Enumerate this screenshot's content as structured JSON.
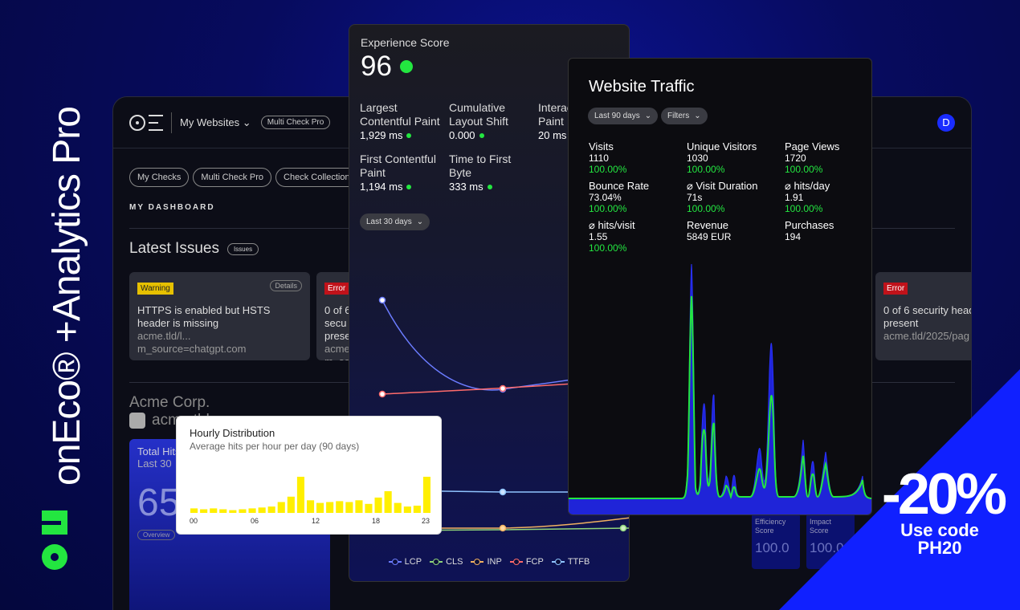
{
  "brand": {
    "vertical_text": "onEco® +Analytics Pro"
  },
  "dashboard": {
    "nav_title": "My Websites",
    "nav_badge": "Multi Check Pro",
    "avatar": "D",
    "tabs": [
      "My Checks",
      "Multi Check Pro",
      "Check Collections"
    ],
    "section_label": "MY DASHBOARD",
    "latest_issues": {
      "title": "Latest Issues",
      "badge": "Issues"
    },
    "issues": [
      {
        "badge": "Warning",
        "details": "Details",
        "text": "HTTPS is enabled but HSTS header is missing",
        "url": "acme.tld/l... m_source=chatgpt.com"
      },
      {
        "badge": "Error",
        "text": "0 of 6 secu present",
        "url": "acme.tld/... m_sou"
      },
      {
        "badge": "Error",
        "text": "0 of 6 security head present",
        "url": "acme.tld/2025/pag"
      }
    ],
    "company": "Acme Corp.",
    "company_domain": "acme.tld",
    "total_card": {
      "title": "Total Hits",
      "subtitle": "Last 30",
      "value": "65",
      "button": "Overview"
    },
    "score_cards": [
      {
        "label": "Efficiency Score",
        "value": "100.0"
      },
      {
        "label": "Impact Score",
        "value": "100.0"
      }
    ]
  },
  "experience": {
    "title": "Experience Score",
    "score": "96",
    "metrics": [
      {
        "label": "Largest Contentful Paint",
        "value": "1,929 ms"
      },
      {
        "label": "Cumulative Layout Shift",
        "value": "0.000"
      },
      {
        "label": "Interaction to Next Paint",
        "value": "20 ms"
      },
      {
        "label": "First Contentful Paint",
        "value": "1,194 ms"
      },
      {
        "label": "Time to First Byte",
        "value": "333 ms"
      }
    ],
    "range": "Last 30 days",
    "legend": [
      {
        "name": "LCP",
        "color": "#6b7cff"
      },
      {
        "name": "CLS",
        "color": "#8fd47a"
      },
      {
        "name": "INP",
        "color": "#f0b060"
      },
      {
        "name": "FCP",
        "color": "#ff6b6b"
      },
      {
        "name": "TTFB",
        "color": "#8fc4ff"
      }
    ]
  },
  "hourly": {
    "title": "Hourly Distribution",
    "subtitle": "Average hits per hour per day (90 days)",
    "ticks": [
      "00",
      "06",
      "12",
      "18",
      "23"
    ],
    "chart_data": {
      "type": "bar",
      "categories": [
        "0",
        "1",
        "2",
        "3",
        "4",
        "5",
        "6",
        "7",
        "8",
        "9",
        "10",
        "11",
        "12",
        "13",
        "14",
        "15",
        "16",
        "17",
        "18",
        "19",
        "20",
        "21",
        "22",
        "23",
        "24"
      ],
      "values": [
        5,
        4,
        5,
        4,
        3,
        4,
        5,
        6,
        7,
        12,
        18,
        40,
        14,
        11,
        12,
        13,
        12,
        14,
        10,
        17,
        24,
        11,
        7,
        8,
        40
      ],
      "color": "#ffef00"
    }
  },
  "traffic": {
    "title": "Website Traffic",
    "range": "Last 90 days",
    "filters": "Filters",
    "metrics": [
      {
        "label": "Visits",
        "value": "1110",
        "pct": "100.00%"
      },
      {
        "label": "Unique Visitors",
        "value": "1030",
        "pct": "100.00%"
      },
      {
        "label": "Page Views",
        "value": "1720",
        "pct": "100.00%"
      },
      {
        "label": "Bounce Rate",
        "value": "73.04%",
        "pct": "100.00%"
      },
      {
        "label": "⌀ Visit Duration",
        "value": "71s",
        "pct": "100.00%"
      },
      {
        "label": "⌀ hits/day",
        "value": "1.91",
        "pct": "100.00%"
      },
      {
        "label": "⌀ hits/visit",
        "value": "1.55",
        "pct": "100.00%"
      },
      {
        "label": "Revenue",
        "value": "5849 EUR"
      },
      {
        "label": "Purchases",
        "value": "194"
      }
    ]
  },
  "promo": {
    "discount": "-20%",
    "line1": "Use code",
    "line2": "PH20"
  }
}
